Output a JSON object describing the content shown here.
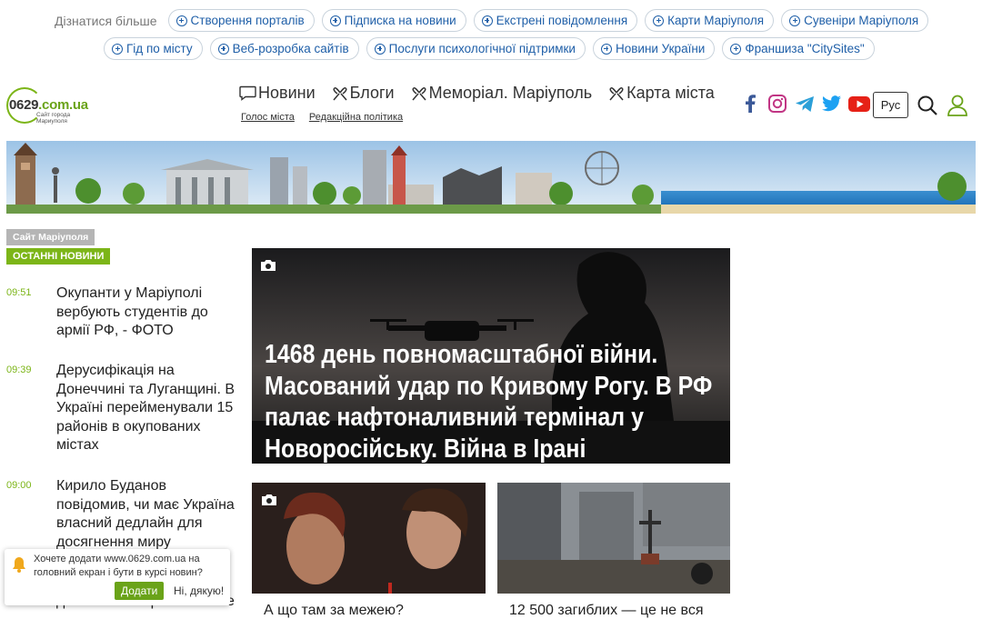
{
  "top_links": {
    "label": "Дізнатися більше",
    "row1": [
      "Створення порталів",
      "Підписка на новини",
      "Екстрені повідомлення",
      "Карти Маріуполя",
      "Сувеніри Маріуполя"
    ],
    "row2": [
      "Гід по місту",
      "Веб-розробка сайтів",
      "Послуги психологічної підтримки",
      "Новини України",
      "Франшиза \"CitySites\""
    ]
  },
  "logo": {
    "main": "0629",
    "domain": ".com.ua",
    "sub_line1": "Сайт города",
    "sub_line2": "Мариуполя"
  },
  "nav": {
    "items": [
      {
        "label": "Новини",
        "icon": "chat-icon"
      },
      {
        "label": "Блоги",
        "icon": "ribbon-icon"
      },
      {
        "label": "Меморіал. Маріуполь",
        "icon": "ribbon-icon"
      },
      {
        "label": "Карта міста",
        "icon": "ribbon-icon"
      }
    ],
    "sub": [
      "Голос міста",
      "Редакційна політика"
    ]
  },
  "social": [
    "facebook-icon",
    "instagram-icon",
    "telegram-icon",
    "twitter-icon",
    "youtube-icon"
  ],
  "lang_button": "Рус",
  "colors": {
    "accent": "#7cb518",
    "link": "#1f5fa8",
    "facebook": "#3b5998",
    "instagram": "#c13584",
    "telegram": "#2a9fd8",
    "twitter": "#1da1f2",
    "youtube": "#e62117"
  },
  "sidebar": {
    "site_tag": "Сайт Маріуполя",
    "latest_tag": "ОСТАННІ НОВИНИ",
    "news": [
      {
        "time": "09:51",
        "title": "Окупанти у Маріуполі вербують студентів до армії РФ, - ФОТО"
      },
      {
        "time": "09:39",
        "title": "Дерусифікація на Донеччині та Луганщині. В Україні перейменували 15 районів в окупованих містах"
      },
      {
        "time": "09:00",
        "title": "Кирило Буданов повідомив, чи має Україна власний дедлайн для досягнення миру"
      },
      {
        "time": "",
        "title": "домовилися про локальне"
      }
    ]
  },
  "feature": {
    "title": "1468 день повномасштабної війни. Масований удар по Кривому Рогу. В РФ палає нафтоналивний термінал у Новоросійську. Війна в Ірані"
  },
  "cards": [
    {
      "title": "А що там за межею?"
    },
    {
      "title": "12 500 загиблих — це не вся"
    }
  ],
  "popup": {
    "message": "Хочете додати www.0629.com.ua на головний екран і бути в курсі новин?",
    "yes": "Додати",
    "no": "Ні, дякую!"
  }
}
